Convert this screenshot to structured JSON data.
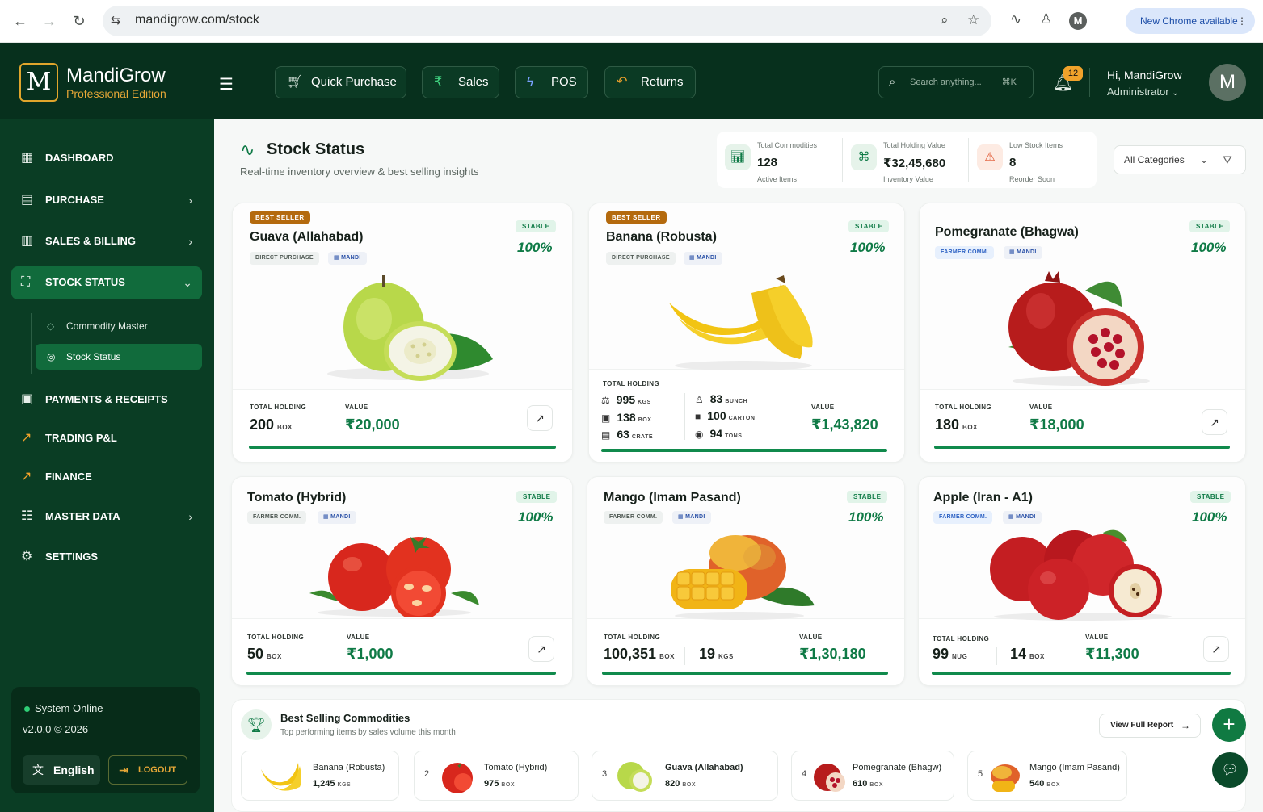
{
  "browser": {
    "url": "mandigrow.com/stock",
    "profile_initial": "M",
    "new_chrome_label": "New Chrome available"
  },
  "brand": {
    "logo_letter": "M",
    "name": "MandiGrow",
    "edition": "Professional Edition"
  },
  "header": {
    "quick_actions": [
      {
        "label": "Quick Purchase",
        "icon": "cart-icon"
      },
      {
        "label": "Sales",
        "icon": "rupee-icon"
      },
      {
        "label": "POS",
        "icon": "bolt-icon"
      },
      {
        "label": "Returns",
        "icon": "return-icon"
      }
    ],
    "search_placeholder": "Search anything...",
    "search_shortcut": "⌘K",
    "notification_count": "12",
    "greeting": "Hi, MandiGrow",
    "role": "Administrator",
    "avatar_initial": "M"
  },
  "sidebar": {
    "items": [
      {
        "label": "DASHBOARD"
      },
      {
        "label": "PURCHASE"
      },
      {
        "label": "SALES & BILLING"
      },
      {
        "label": "STOCK STATUS"
      },
      {
        "label": "PAYMENTS & RECEIPTS"
      },
      {
        "label": "TRADING P&L"
      },
      {
        "label": "FINANCE"
      },
      {
        "label": "MASTER DATA"
      },
      {
        "label": "SETTINGS"
      }
    ],
    "subitems": [
      {
        "label": "Commodity Master"
      },
      {
        "label": "Stock Status"
      }
    ],
    "system_status": "System Online",
    "version": "v2.0.0 © 2026",
    "language": "English",
    "logout": "LOGOUT"
  },
  "page": {
    "title": "Stock Status",
    "subtitle": "Real-time inventory overview & best selling insights",
    "stats": [
      {
        "label": "Total Commodities",
        "value": "128",
        "foot": "Active Items",
        "color": "#0f7a46"
      },
      {
        "label": "Total Holding Value",
        "value": "₹32,45,680",
        "foot": "Inventory Value",
        "color": "#0f7a46"
      },
      {
        "label": "Low Stock Items",
        "value": "8",
        "foot": "Reorder Soon",
        "color": "#e0532c"
      }
    ],
    "category_filter": "All Categories"
  },
  "cards": [
    {
      "name": "Guava (Allahabad)",
      "best_seller": "BEST SELLER",
      "source": "DIRECT PURCHASE",
      "mandi": "MANDI",
      "status": "STABLE",
      "percent": "100%",
      "holding_label": "TOTAL HOLDING",
      "value_label": "VALUE",
      "holding": "200",
      "unit": "BOX",
      "value": "₹20,000",
      "fill": 1.0
    },
    {
      "name": "Banana (Robusta)",
      "best_seller": "BEST SELLER",
      "source": "DIRECT PURCHASE",
      "mandi": "MANDI",
      "status": "STABLE",
      "percent": "100%",
      "holding_label": "TOTAL HOLDING",
      "value_label": "VALUE",
      "multi": [
        {
          "qty": "995",
          "unit": "KGS"
        },
        {
          "qty": "138",
          "unit": "BOX"
        },
        {
          "qty": "63",
          "unit": "CRATE"
        },
        {
          "qty": "83",
          "unit": "BUNCH"
        },
        {
          "qty": "100",
          "unit": "CARTON"
        },
        {
          "qty": "94",
          "unit": "TONS"
        }
      ],
      "value": "₹1,43,820",
      "fill": 1.0
    },
    {
      "name": "Pomegranate (Bhagwa)",
      "source": "FARMER COMM.",
      "mandi": "MANDI",
      "status": "STABLE",
      "percent": "100%",
      "holding_label": "TOTAL HOLDING",
      "value_label": "VALUE",
      "holding": "180",
      "unit": "BOX",
      "value": "₹18,000",
      "fill": 1.0
    },
    {
      "name": "Tomato (Hybrid)",
      "source": "FARMER COMM.",
      "mandi": "MANDI",
      "status": "STABLE",
      "percent": "100%",
      "holding_label": "TOTAL HOLDING",
      "value_label": "VALUE",
      "holding": "50",
      "unit": "BOX",
      "value": "₹1,000",
      "fill": 1.0
    },
    {
      "name": "Mango (Imam Pasand)",
      "source": "FARMER COMM.",
      "mandi": "MANDI",
      "status": "STABLE",
      "percent": "100%",
      "holding_label": "TOTAL HOLDING",
      "value_label": "VALUE",
      "holding": "100,351",
      "unit": "BOX",
      "holding2": "19",
      "unit2": "KGS",
      "value": "₹1,30,180",
      "fill": 1.0
    },
    {
      "name": "Apple (Iran - A1)",
      "source": "FARMER COMM.",
      "mandi": "MANDI",
      "status": "STABLE",
      "percent": "100%",
      "holding_label": "TOTAL HOLDING",
      "value_label": "VALUE",
      "holding": "99",
      "unit": "NUG",
      "holding2": "14",
      "unit2": "BOX",
      "value": "₹11,300",
      "fill": 1.0
    }
  ],
  "best_selling": {
    "title": "Best Selling Commodities",
    "subtitle": "Top performing items by sales volume this month",
    "view_report": "View Full Report",
    "items": [
      {
        "rank": "",
        "name": "Banana (Robusta)",
        "qty": "1,245",
        "unit": "KGS"
      },
      {
        "rank": "2",
        "name": "Tomato (Hybrid)",
        "qty": "975",
        "unit": "BOX"
      },
      {
        "rank": "3",
        "name": "Guava (Allahabad)",
        "qty": "820",
        "unit": "BOX"
      },
      {
        "rank": "4",
        "name": "Pomegranate (Bhagw)",
        "qty": "610",
        "unit": "BOX"
      },
      {
        "rank": "5",
        "name": "Mango (Imam Pasand)",
        "qty": "540",
        "unit": "BOX"
      }
    ]
  }
}
